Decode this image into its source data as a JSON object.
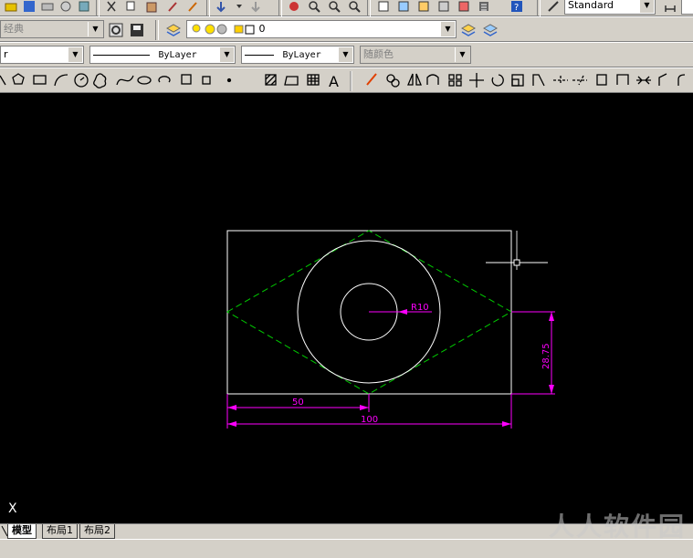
{
  "toolbar": {
    "text_style": "Standard",
    "workspace": "经典",
    "layer_name": "0",
    "color": "ByLayer",
    "linetype": "ByLayer",
    "plot_style": "随颜色",
    "row1_icons": [
      "zoom-icon",
      "pan-icon",
      "calculator-icon",
      "properties-icon",
      "help-icon"
    ],
    "draw_icons": [
      "polygon-icon",
      "rectangle-icon",
      "arc-icon",
      "circle-icon",
      "revision-cloud-icon",
      "spline-icon",
      "ellipse-icon",
      "ellipse-arc-icon",
      "insert-block-icon",
      "make-block-icon",
      "point-icon",
      "hatch-icon",
      "region-icon",
      "table-icon",
      "multiline-text-icon"
    ],
    "modify_icons": [
      "erase-icon",
      "copy-icon",
      "mirror-icon",
      "offset-icon",
      "array-icon",
      "move-icon",
      "rotate-icon",
      "scale-icon",
      "stretch-icon",
      "trim-icon",
      "extend-icon",
      "break-at-point-icon",
      "break-icon",
      "join-icon",
      "chamfer-icon",
      "fillet-icon"
    ],
    "style_short": "Standard"
  },
  "drawing": {
    "radius_label": "R10",
    "dim_height": "28.75",
    "dim_half": "50",
    "dim_width": "100",
    "colors": {
      "geometry": "#ffffff",
      "construction": "#00cc00",
      "dimension": "#ff00ff",
      "background": "#000000"
    }
  },
  "ucs_label": "X",
  "tabs": [
    "模型",
    "布局1",
    "布局2"
  ],
  "watermark": "人人软件园"
}
